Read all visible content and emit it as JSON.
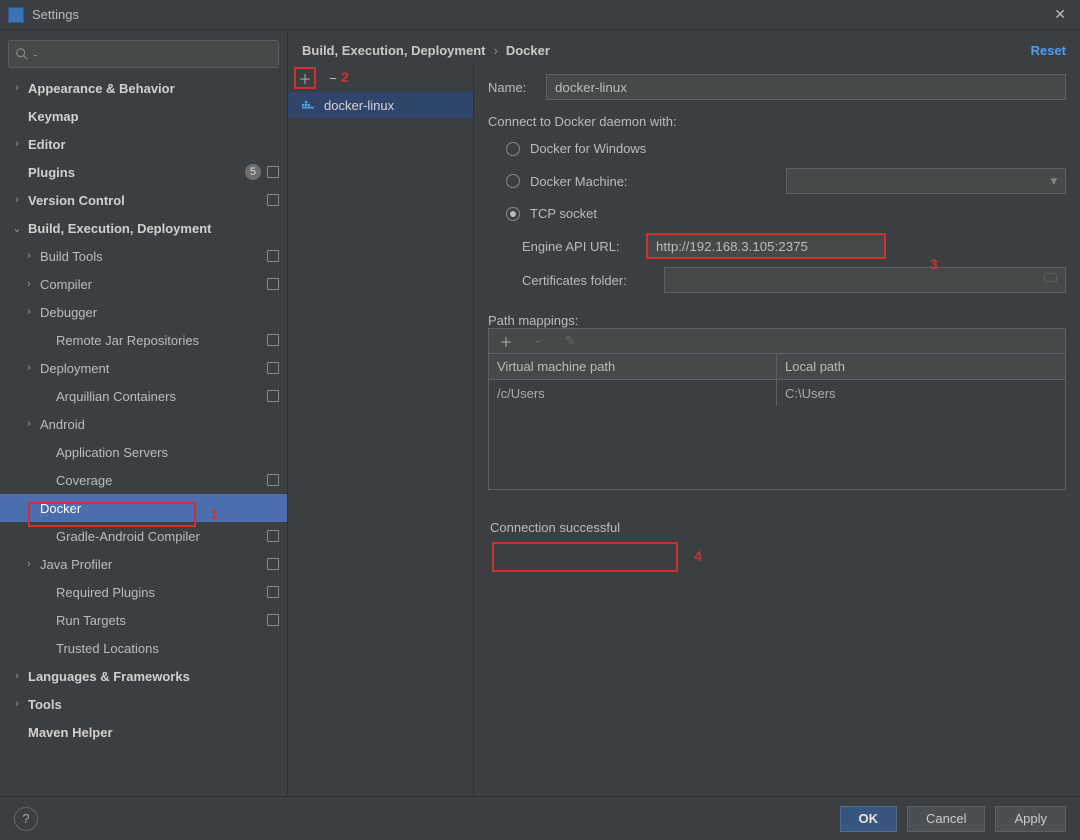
{
  "window": {
    "title": "Settings"
  },
  "breadcrumb": {
    "a": "Build, Execution, Deployment",
    "b": "Docker",
    "reset": "Reset"
  },
  "sidebar": {
    "items": [
      {
        "label": "Appearance & Behavior",
        "chev": ">",
        "bold": true
      },
      {
        "label": "Keymap",
        "bold": true
      },
      {
        "label": "Editor",
        "chev": ">",
        "bold": true
      },
      {
        "label": "Plugins",
        "bold": true,
        "badge": "5",
        "sq": true
      },
      {
        "label": "Version Control",
        "chev": ">",
        "bold": true,
        "sq": true
      },
      {
        "label": "Build, Execution, Deployment",
        "chev": "v",
        "bold": true
      },
      {
        "label": "Build Tools",
        "chev": ">",
        "depth": 1,
        "sq": true
      },
      {
        "label": "Compiler",
        "chev": ">",
        "depth": 1,
        "sq": true
      },
      {
        "label": "Debugger",
        "chev": ">",
        "depth": 1
      },
      {
        "label": "Remote Jar Repositories",
        "depth": 2,
        "sq": true
      },
      {
        "label": "Deployment",
        "chev": ">",
        "depth": 1,
        "sq": true
      },
      {
        "label": "Arquillian Containers",
        "depth": 2,
        "sq": true
      },
      {
        "label": "Android",
        "chev": ">",
        "depth": 1
      },
      {
        "label": "Application Servers",
        "depth": 2
      },
      {
        "label": "Coverage",
        "depth": 2,
        "sq": true
      },
      {
        "label": "Docker",
        "chev": ">",
        "depth": 1,
        "selected": true
      },
      {
        "label": "Gradle-Android Compiler",
        "depth": 2,
        "sq": true
      },
      {
        "label": "Java Profiler",
        "chev": ">",
        "depth": 1,
        "sq": true
      },
      {
        "label": "Required Plugins",
        "depth": 2,
        "sq": true
      },
      {
        "label": "Run Targets",
        "depth": 2,
        "sq": true
      },
      {
        "label": "Trusted Locations",
        "depth": 2
      },
      {
        "label": "Languages & Frameworks",
        "chev": ">",
        "bold": true
      },
      {
        "label": "Tools",
        "chev": ">",
        "bold": true
      },
      {
        "label": "Maven Helper",
        "bold": true
      }
    ]
  },
  "list": {
    "selected": "docker-linux"
  },
  "form": {
    "name_label": "Name:",
    "name_value": "docker-linux",
    "connect_label": "Connect to Docker daemon with:",
    "r_win": "Docker for Windows",
    "r_machine": "Docker Machine:",
    "r_tcp": "TCP socket",
    "engine_label": "Engine API URL:",
    "engine_value": "http://192.168.3.105:2375",
    "cert_label": "Certificates folder:",
    "pm_label": "Path mappings:",
    "pm_h1": "Virtual machine path",
    "pm_h2": "Local path",
    "pm_v1": "/c/Users",
    "pm_v2": "C:\\Users",
    "status": "Connection successful"
  },
  "footer": {
    "ok": "OK",
    "cancel": "Cancel",
    "apply": "Apply"
  },
  "ann": {
    "a1": "1",
    "a2": "2",
    "a3": "3",
    "a4": "4"
  }
}
